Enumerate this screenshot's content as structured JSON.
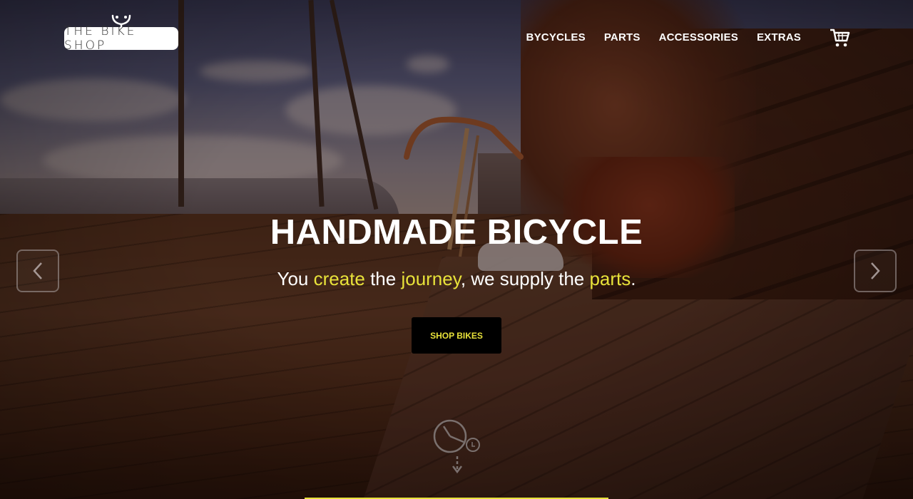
{
  "header": {
    "logo_text": "THE BIKE SHOP",
    "nav": [
      {
        "label": "BYCYCLES"
      },
      {
        "label": "PARTS"
      },
      {
        "label": "ACCESSORIES"
      },
      {
        "label": "EXTRAS"
      }
    ],
    "cart_icon": "shopping-cart-icon"
  },
  "hero": {
    "title": "HANDMADE BICYCLE",
    "subtitle_parts": [
      "You ",
      "create",
      " the ",
      "journey",
      ", we supply the ",
      "parts",
      "."
    ],
    "cta_label": "SHOP BIKES",
    "prev_icon": "chevron-left-icon",
    "next_icon": "chevron-right-icon",
    "scroll_icon": "clock-scroll-down-icon"
  },
  "colors": {
    "accent": "#e8e23a",
    "text": "#ffffff",
    "button_bg": "#000000"
  }
}
